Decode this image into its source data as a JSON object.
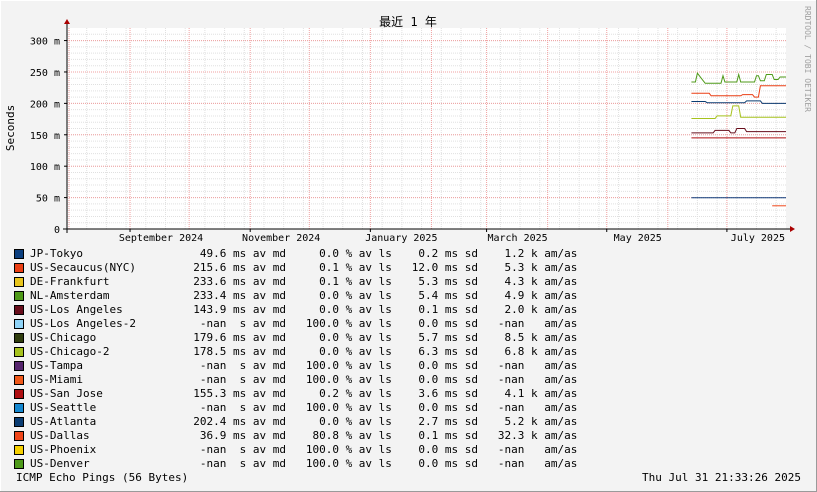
{
  "chart_data": {
    "type": "line",
    "title": "最近 1 年",
    "ylabel": "Seconds",
    "watermark": "RRDTOOL / TOBI OETIKER",
    "ylim": [
      0,
      0.32
    ],
    "y_ticks": [
      {
        "value": 0,
        "label": "0"
      },
      {
        "value": 0.05,
        "label": "50 m"
      },
      {
        "value": 0.1,
        "label": "100 m"
      },
      {
        "value": 0.15,
        "label": "150 m"
      },
      {
        "value": 0.2,
        "label": "200 m"
      },
      {
        "value": 0.25,
        "label": "250 m"
      },
      {
        "value": 0.3,
        "label": "300 m"
      }
    ],
    "x_ticks": [
      {
        "date": "2024-09-01",
        "label": "September 2024"
      },
      {
        "date": "2024-11-01",
        "label": "November 2024"
      },
      {
        "date": "2025-01-01",
        "label": "January 2025"
      },
      {
        "date": "2025-03-01",
        "label": "March 2025"
      },
      {
        "date": "2025-05-01",
        "label": "May 2025"
      },
      {
        "date": "2025-07-01",
        "label": "July 2025"
      }
    ],
    "x_range": [
      "2024-07-31",
      "2025-07-31"
    ],
    "grid": true,
    "legend_position": "bottom",
    "series": [
      {
        "name": "JP-Tokyo",
        "color": "#0b3e7e",
        "points": [
          [
            "2025-06-13",
            0.0496
          ],
          [
            "2025-07-31",
            0.0496
          ]
        ]
      },
      {
        "name": "US-Secaucus(NYC)",
        "color": "#ea3f14",
        "points": [
          [
            "2025-06-13",
            0.216
          ],
          [
            "2025-06-22",
            0.216
          ],
          [
            "2025-06-23",
            0.212
          ],
          [
            "2025-07-08",
            0.212
          ],
          [
            "2025-07-09",
            0.214
          ],
          [
            "2025-07-14",
            0.214
          ],
          [
            "2025-07-15",
            0.21
          ],
          [
            "2025-07-17",
            0.21
          ],
          [
            "2025-07-18",
            0.228
          ],
          [
            "2025-07-31",
            0.228
          ]
        ]
      },
      {
        "name": "DE-Frankfurt",
        "color": "#e8c51c",
        "points": []
      },
      {
        "name": "NL-Amsterdam",
        "color": "#4f9a19",
        "points": [
          [
            "2025-06-13",
            0.234
          ],
          [
            "2025-06-15",
            0.234
          ],
          [
            "2025-06-16",
            0.248
          ],
          [
            "2025-06-18",
            0.24
          ],
          [
            "2025-06-20",
            0.232
          ],
          [
            "2025-06-28",
            0.232
          ],
          [
            "2025-06-29",
            0.244
          ],
          [
            "2025-06-30",
            0.234
          ],
          [
            "2025-07-06",
            0.234
          ],
          [
            "2025-07-07",
            0.246
          ],
          [
            "2025-07-08",
            0.234
          ],
          [
            "2025-07-15",
            0.234
          ],
          [
            "2025-07-16",
            0.244
          ],
          [
            "2025-07-17",
            0.244
          ],
          [
            "2025-07-18",
            0.236
          ],
          [
            "2025-07-20",
            0.236
          ],
          [
            "2025-07-21",
            0.246
          ],
          [
            "2025-07-24",
            0.246
          ],
          [
            "2025-07-25",
            0.238
          ],
          [
            "2025-07-27",
            0.238
          ],
          [
            "2025-07-28",
            0.242
          ],
          [
            "2025-07-31",
            0.242
          ]
        ]
      },
      {
        "name": "US-Los Angeles",
        "color": "#680d1b",
        "points": [
          [
            "2025-06-13",
            0.153
          ],
          [
            "2025-06-24",
            0.153
          ],
          [
            "2025-06-25",
            0.157
          ],
          [
            "2025-07-02",
            0.157
          ],
          [
            "2025-07-03",
            0.153
          ],
          [
            "2025-07-05",
            0.153
          ],
          [
            "2025-07-06",
            0.16
          ],
          [
            "2025-07-10",
            0.16
          ],
          [
            "2025-07-11",
            0.155
          ],
          [
            "2025-07-31",
            0.155
          ]
        ]
      },
      {
        "name": "US-Los Angeles-2",
        "color": "#8fd3f7",
        "points": []
      },
      {
        "name": "US-Chicago",
        "color": "#2f3c0d",
        "points": []
      },
      {
        "name": "US-Chicago-2",
        "color": "#a6c21d",
        "points": [
          [
            "2025-06-13",
            0.176
          ],
          [
            "2025-06-25",
            0.176
          ],
          [
            "2025-06-26",
            0.18
          ],
          [
            "2025-07-03",
            0.18
          ],
          [
            "2025-07-04",
            0.196
          ],
          [
            "2025-07-07",
            0.196
          ],
          [
            "2025-07-08",
            0.178
          ],
          [
            "2025-07-31",
            0.178
          ]
        ]
      },
      {
        "name": "US-Tampa",
        "color": "#56256e",
        "points": []
      },
      {
        "name": "US-Miami",
        "color": "#f0591a",
        "points": []
      },
      {
        "name": "US-San Jose",
        "color": "#ae0e11",
        "points": [
          [
            "2025-06-13",
            0.145
          ],
          [
            "2025-07-31",
            0.145
          ]
        ]
      },
      {
        "name": "US-Seattle",
        "color": "#1587cf",
        "points": []
      },
      {
        "name": "US-Atlanta",
        "color": "#0a3c72",
        "points": [
          [
            "2025-06-13",
            0.203
          ],
          [
            "2025-06-20",
            0.203
          ],
          [
            "2025-06-21",
            0.201
          ],
          [
            "2025-07-10",
            0.201
          ],
          [
            "2025-07-11",
            0.204
          ],
          [
            "2025-07-18",
            0.204
          ],
          [
            "2025-07-19",
            0.2
          ],
          [
            "2025-07-31",
            0.2
          ]
        ]
      },
      {
        "name": "US-Dallas",
        "color": "#f0461a",
        "points": [
          [
            "2025-07-24",
            0.037
          ],
          [
            "2025-07-31",
            0.037
          ]
        ]
      },
      {
        "name": "US-Phoenix",
        "color": "#f5cf00",
        "points": []
      },
      {
        "name": "US-Denver",
        "color": "#4e9a1a",
        "points": []
      }
    ]
  },
  "legend": [
    {
      "name": "JP-Tokyo",
      "color": "#0b3e7e",
      "stats": "   49.6 ms av md     0.0 % av ls    0.2 ms sd    1.2 k am/as"
    },
    {
      "name": "US-Secaucus(NYC)",
      "color": "#ea3f14",
      "stats": "  215.6 ms av md     0.1 % av ls   12.0 ms sd    5.3 k am/as"
    },
    {
      "name": "DE-Frankfurt",
      "color": "#e8c51c",
      "stats": "  233.6 ms av md     0.1 % av ls    5.3 ms sd    4.3 k am/as"
    },
    {
      "name": "NL-Amsterdam",
      "color": "#4f9a19",
      "stats": "  233.4 ms av md     0.0 % av ls    5.4 ms sd    4.9 k am/as"
    },
    {
      "name": "US-Los Angeles",
      "color": "#680d1b",
      "stats": "  143.9 ms av md     0.0 % av ls    0.1 ms sd    2.0 k am/as"
    },
    {
      "name": "US-Los Angeles-2",
      "color": "#8fd3f7",
      "stats": "   -nan  s av md   100.0 % av ls    0.0 ms sd   -nan   am/as"
    },
    {
      "name": "US-Chicago",
      "color": "#2f3c0d",
      "stats": "  179.6 ms av md     0.0 % av ls    5.7 ms sd    8.5 k am/as"
    },
    {
      "name": "US-Chicago-2",
      "color": "#a6c21d",
      "stats": "  178.5 ms av md     0.0 % av ls    6.3 ms sd    6.8 k am/as"
    },
    {
      "name": "US-Tampa",
      "color": "#56256e",
      "stats": "   -nan  s av md   100.0 % av ls    0.0 ms sd   -nan   am/as"
    },
    {
      "name": "US-Miami",
      "color": "#f0591a",
      "stats": "   -nan  s av md   100.0 % av ls    0.0 ms sd   -nan   am/as"
    },
    {
      "name": "US-San Jose",
      "color": "#ae0e11",
      "stats": "  155.3 ms av md     0.2 % av ls    3.6 ms sd    4.1 k am/as"
    },
    {
      "name": "US-Seattle",
      "color": "#1587cf",
      "stats": "   -nan  s av md   100.0 % av ls    0.0 ms sd   -nan   am/as"
    },
    {
      "name": "US-Atlanta",
      "color": "#0a3c72",
      "stats": "  202.4 ms av md     0.0 % av ls    2.7 ms sd    5.2 k am/as"
    },
    {
      "name": "US-Dallas",
      "color": "#f0461a",
      "stats": "   36.9 ms av md    80.8 % av ls    0.1 ms sd   32.3 k am/as"
    },
    {
      "name": "US-Phoenix",
      "color": "#f5cf00",
      "stats": "   -nan  s av md   100.0 % av ls    0.0 ms sd   -nan   am/as"
    },
    {
      "name": "US-Denver",
      "color": "#4e9a1a",
      "stats": "   -nan  s av md   100.0 % av ls    0.0 ms sd   -nan   am/as"
    }
  ],
  "footer": {
    "left": "ICMP Echo Pings (56 Bytes)",
    "right": "Thu Jul 31 21:33:26 2025"
  }
}
